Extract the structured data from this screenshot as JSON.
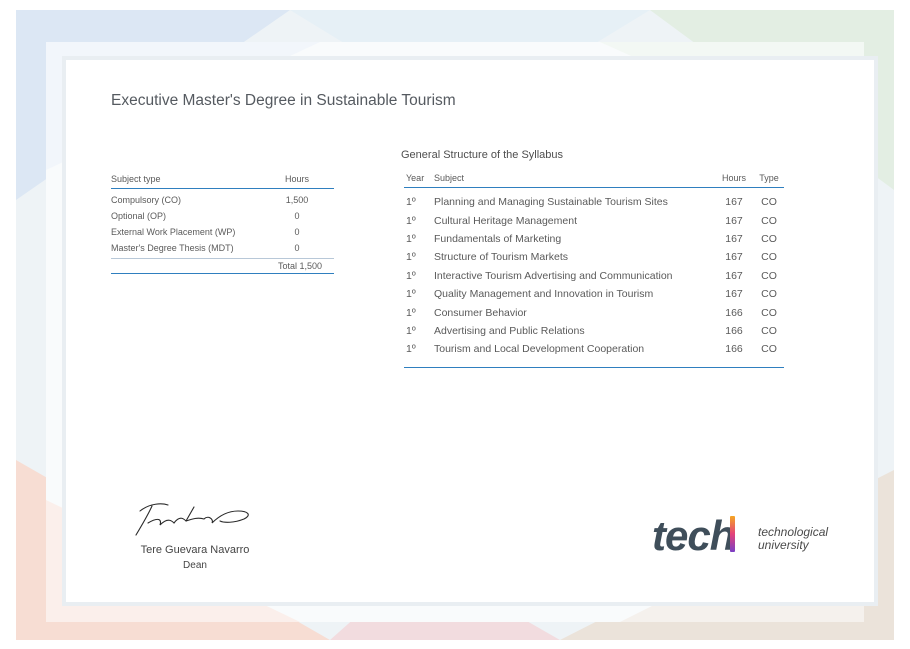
{
  "document": {
    "title": "Executive Master's Degree in Sustainable Tourism"
  },
  "summary": {
    "headers": {
      "type": "Subject type",
      "hours": "Hours"
    },
    "rows": [
      {
        "type": "Compulsory (CO)",
        "hours": "1,500"
      },
      {
        "type": "Optional (OP)",
        "hours": "0"
      },
      {
        "type": "External Work Placement (WP)",
        "hours": "0"
      },
      {
        "type": "Master's Degree Thesis (MDT)",
        "hours": "0"
      }
    ],
    "total": "Total 1,500"
  },
  "syllabus": {
    "caption": "General Structure of the Syllabus",
    "headers": {
      "year": "Year",
      "subject": "Subject",
      "hours": "Hours",
      "type": "Type"
    },
    "rows": [
      {
        "year": "1º",
        "subject": "Planning and Managing Sustainable Tourism Sites",
        "hours": "167",
        "type": "CO"
      },
      {
        "year": "1º",
        "subject": "Cultural Heritage Management",
        "hours": "167",
        "type": "CO"
      },
      {
        "year": "1º",
        "subject": "Fundamentals of Marketing",
        "hours": "167",
        "type": "CO"
      },
      {
        "year": "1º",
        "subject": "Structure of Tourism Markets",
        "hours": "167",
        "type": "CO"
      },
      {
        "year": "1º",
        "subject": "Interactive Tourism Advertising and Communication",
        "hours": "167",
        "type": "CO"
      },
      {
        "year": "1º",
        "subject": "Quality Management and Innovation in Tourism",
        "hours": "167",
        "type": "CO"
      },
      {
        "year": "1º",
        "subject": "Consumer Behavior",
        "hours": "166",
        "type": "CO"
      },
      {
        "year": "1º",
        "subject": "Advertising and Public Relations",
        "hours": "166",
        "type": "CO"
      },
      {
        "year": "1º",
        "subject": "Tourism and Local Development Cooperation",
        "hours": "166",
        "type": "CO"
      }
    ]
  },
  "signatory": {
    "name": "Tere Guevara Navarro",
    "role": "Dean"
  },
  "logo": {
    "word": "tech",
    "line1": "technological",
    "line2": "university"
  },
  "colors": {
    "accent_blue": "#2f7fbf",
    "logo_dark": "#3f4e5a",
    "logo_gradient": [
      "#7a3fc4",
      "#e4427a",
      "#f5a623"
    ]
  }
}
